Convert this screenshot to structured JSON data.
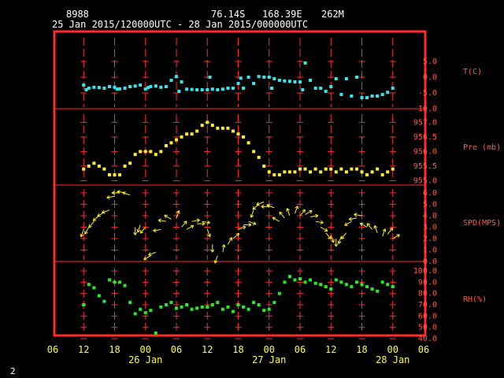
{
  "header": {
    "station": "8988",
    "lat": "76.14S",
    "lon": "168.39E",
    "elev": "262M",
    "range": "25 Jan 2015/120000UTC - 28 Jan 2015/000000UTC"
  },
  "footer": {
    "page": "2"
  },
  "chart_data": {
    "type": "scatter",
    "x_ticks": [
      "06",
      "12",
      "18",
      "00",
      "06",
      "12",
      "18",
      "00",
      "06",
      "12",
      "18",
      "00",
      "06"
    ],
    "x_dates": [
      "26 Jan",
      "27 Jan",
      "28 Jan"
    ],
    "panels": [
      {
        "label": "T(C)",
        "ticks": [
          "5.0",
          "0.0",
          "-5.0",
          "-10.0"
        ],
        "ylim": [
          -10,
          10
        ],
        "color": "#33e6f0",
        "x": [
          12,
          13,
          14,
          15,
          16,
          17,
          18,
          19,
          20,
          21,
          22,
          23,
          24,
          25,
          26,
          27,
          28,
          29,
          30,
          31,
          32,
          33,
          34,
          35,
          36,
          37,
          38,
          39,
          40,
          41,
          42,
          43,
          44,
          45,
          46,
          47,
          48,
          49,
          50,
          51,
          52,
          53,
          54,
          55,
          56,
          57,
          58,
          59,
          60,
          61,
          62,
          63,
          64,
          65,
          66,
          67,
          68,
          69,
          70,
          71,
          72,
          12.5,
          18.5,
          24.5,
          30.5,
          36.5,
          42.5,
          48.5,
          54.5
        ],
        "y": [
          -2.5,
          -3.5,
          -3.2,
          -3.3,
          -3.5,
          -3.0,
          -3.2,
          -3.7,
          -3.5,
          -3.0,
          -2.8,
          -2.5,
          -3.8,
          -3.0,
          -2.8,
          -3.2,
          -3.0,
          -1.0,
          0.2,
          -1.5,
          -3.8,
          -3.9,
          -4.0,
          -4.0,
          -4.0,
          -3.8,
          -4.0,
          -3.8,
          -3.5,
          -3.5,
          -2.0,
          -3.5,
          0.0,
          -2.0,
          0.2,
          0.0,
          0.0,
          -0.5,
          -1.0,
          -1.2,
          -1.3,
          -1.5,
          -1.5,
          4.5,
          -1.0,
          -3.5,
          -3.5,
          -4.5,
          -3.0,
          -0.5,
          -5.5,
          -0.5,
          -6.0,
          0.0,
          -6.5,
          -6.5,
          -6.0,
          -6.0,
          -5.5,
          -4.8,
          -3.5,
          -4.0,
          -3.8,
          -3.3,
          -4.5,
          0.0,
          -0.3,
          -3.5,
          -4.0
        ]
      },
      {
        "label": "Pre (mb)",
        "ticks": [
          "957.0",
          "956.5",
          "956.0",
          "955.5",
          "955.0"
        ],
        "ylim": [
          954.85,
          957.2
        ],
        "color": "#ffee22",
        "x": [
          12,
          13,
          14,
          15,
          16,
          17,
          18,
          19,
          20,
          21,
          22,
          23,
          24,
          25,
          26,
          27,
          28,
          29,
          30,
          31,
          32,
          33,
          34,
          35,
          36,
          37,
          38,
          39,
          40,
          41,
          42,
          43,
          44,
          45,
          46,
          47,
          48,
          49,
          50,
          51,
          52,
          53,
          54,
          55,
          56,
          57,
          58,
          59,
          60,
          61,
          62,
          63,
          64,
          65,
          66,
          67,
          68,
          69,
          70,
          71,
          72
        ],
        "y": [
          955.4,
          955.5,
          955.6,
          955.5,
          955.4,
          955.2,
          955.2,
          955.2,
          955.5,
          955.6,
          955.9,
          956.0,
          956.0,
          956.0,
          955.9,
          956.0,
          956.2,
          956.3,
          956.4,
          956.5,
          956.6,
          956.6,
          956.7,
          956.9,
          957.0,
          956.9,
          956.8,
          956.8,
          956.8,
          956.7,
          956.6,
          956.5,
          956.3,
          956.0,
          955.8,
          955.5,
          955.3,
          955.2,
          955.2,
          955.3,
          955.3,
          955.3,
          955.4,
          955.4,
          955.3,
          955.4,
          955.3,
          955.4,
          955.4,
          955.3,
          955.4,
          955.3,
          955.4,
          955.4,
          955.3,
          955.2,
          955.3,
          955.4,
          955.2,
          955.3,
          955.4
        ]
      },
      {
        "label": "SPD(MPS)",
        "ticks": [
          "6.0",
          "5.0",
          "4.0",
          "3.0",
          "2.0",
          "1.0",
          "0.0"
        ],
        "ylim": [
          0,
          6.2
        ],
        "color": "#ffee22",
        "x": [
          12,
          13,
          14,
          15,
          16,
          17,
          18,
          19,
          20,
          21,
          22,
          23,
          24,
          25,
          26,
          27,
          28,
          29,
          30,
          31,
          32,
          33,
          34,
          35,
          36,
          37,
          38,
          39,
          40,
          41,
          42,
          43,
          44,
          45,
          46,
          47,
          48,
          49,
          50,
          51,
          52,
          53,
          54,
          55,
          56,
          57,
          58,
          59,
          60,
          61,
          62,
          63,
          64,
          65,
          66,
          67,
          68,
          69,
          70,
          71,
          72
        ],
        "y": [
          2.8,
          3.0,
          3.5,
          4.0,
          4.3,
          4.5,
          5.7,
          6.0,
          6.0,
          5.8,
          3.0,
          3.2,
          3.0,
          0.5,
          0.8,
          2.8,
          3.5,
          3.7,
          3.8,
          3.0,
          2.8,
          3.5,
          3.3,
          3.5,
          2.8,
          1.5,
          0.5,
          0.8,
          1.5,
          2.0,
          2.8,
          3.2,
          3.5,
          4.5,
          5.0,
          5.2,
          4.8,
          4.7,
          3.5,
          3.8,
          4.0,
          4.2,
          4.0,
          4.1,
          3.9,
          3.5,
          3.0,
          2.5,
          2.3,
          2.0,
          2.2,
          2.5,
          3.5,
          3.8,
          4.0,
          3.0,
          2.8,
          2.5,
          2.2,
          2.4,
          2.0
        ],
        "dir": [
          200,
          210,
          220,
          230,
          240,
          250,
          260,
          270,
          280,
          290,
          180,
          200,
          220,
          240,
          250,
          260,
          280,
          300,
          20,
          40,
          60,
          80,
          90,
          100,
          160,
          180,
          200,
          10,
          30,
          50,
          70,
          90,
          110,
          200,
          230,
          250,
          270,
          290,
          300,
          320,
          340,
          20,
          40,
          60,
          80,
          100,
          120,
          140,
          160,
          180,
          200,
          220,
          240,
          260,
          280,
          300,
          320,
          340,
          20,
          40,
          60
        ]
      },
      {
        "label": "RH(%)",
        "ticks": [
          "100.0",
          "90.0",
          "80.0",
          "70.0",
          "60.0",
          "50.0",
          "40.0"
        ],
        "ylim": [
          40,
          100
        ],
        "color": "#22ee22",
        "x": [
          12,
          13,
          14,
          15,
          16,
          17,
          18,
          19,
          20,
          21,
          22,
          23,
          24,
          25,
          26,
          27,
          28,
          29,
          30,
          31,
          32,
          33,
          34,
          35,
          36,
          37,
          38,
          39,
          40,
          41,
          42,
          43,
          44,
          45,
          46,
          47,
          48,
          49,
          50,
          51,
          52,
          53,
          54,
          55,
          56,
          57,
          58,
          59,
          60,
          61,
          62,
          63,
          64,
          65,
          66,
          67,
          68,
          69,
          70,
          71,
          72
        ],
        "y": [
          70,
          88,
          85,
          78,
          73,
          92,
          90,
          90,
          87,
          72,
          62,
          66,
          63,
          65,
          45,
          68,
          70,
          72,
          67,
          68,
          70,
          66,
          67,
          68,
          68,
          70,
          72,
          66,
          68,
          64,
          70,
          68,
          66,
          72,
          70,
          65,
          66,
          72,
          80,
          90,
          95,
          92,
          93,
          90,
          92,
          89,
          88,
          86,
          84,
          92,
          90,
          88,
          86,
          90,
          88,
          86,
          84,
          82,
          90,
          88,
          86
        ]
      }
    ]
  }
}
